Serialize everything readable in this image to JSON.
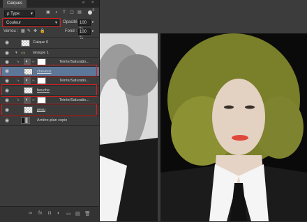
{
  "panel": {
    "title": "Calques",
    "collapse_glyph": "«",
    "close_glyph": "×",
    "menu_glyph": "≡",
    "filter": {
      "label": "ρ Type",
      "arrow": "▾"
    },
    "filter_icons": [
      "image-filter-icon",
      "adjustment-filter-icon",
      "text-filter-icon",
      "shape-filter-icon",
      "smart-object-filter-icon"
    ],
    "blend_mode": {
      "value": "Couleur",
      "arrow": "▾"
    },
    "opacity": {
      "label": "Opacité :",
      "value": "100 %",
      "arrow": "▸"
    },
    "lock": {
      "label": "Verrou :",
      "icons": [
        "lock-pixels-icon",
        "lock-paint-icon",
        "lock-move-icon",
        "lock-all-icon"
      ]
    },
    "fill": {
      "label": "Fond :",
      "value": "100 %",
      "arrow": "▸"
    }
  },
  "layers": [
    {
      "name": "Calque 0",
      "type": "layer",
      "visible": true
    },
    {
      "name": "Groupe 1",
      "type": "group",
      "visible": true,
      "expanded": true
    },
    {
      "name": "Teinte/Saturatio...",
      "type": "adjustment",
      "visible": true,
      "clipped": true
    },
    {
      "name": "cheveux",
      "type": "layer",
      "visible": true,
      "selected": true,
      "highlighted": true
    },
    {
      "name": "Teinte/Saturatio...",
      "type": "adjustment",
      "visible": true,
      "clipped": true
    },
    {
      "name": "bouche",
      "type": "layer",
      "visible": true,
      "highlighted": true
    },
    {
      "name": "Teinte/Saturatio...",
      "type": "adjustment",
      "visible": true,
      "clipped": true
    },
    {
      "name": "peau",
      "type": "layer",
      "visible": true,
      "highlighted": true
    },
    {
      "name": "Arrière-plan copie",
      "type": "layer",
      "visible": true
    }
  ],
  "bottom_icons": [
    "link-layers-icon",
    "fx-icon",
    "add-mask-icon",
    "new-adjustment-icon",
    "new-group-icon",
    "new-layer-icon",
    "delete-layer-icon"
  ],
  "bottom_glyphs": [
    "∞",
    "fx",
    "◘",
    "◐",
    "▭",
    "▤",
    "🗑"
  ],
  "highlight_color": "#d21f1f",
  "selection_color": "#5d7799"
}
